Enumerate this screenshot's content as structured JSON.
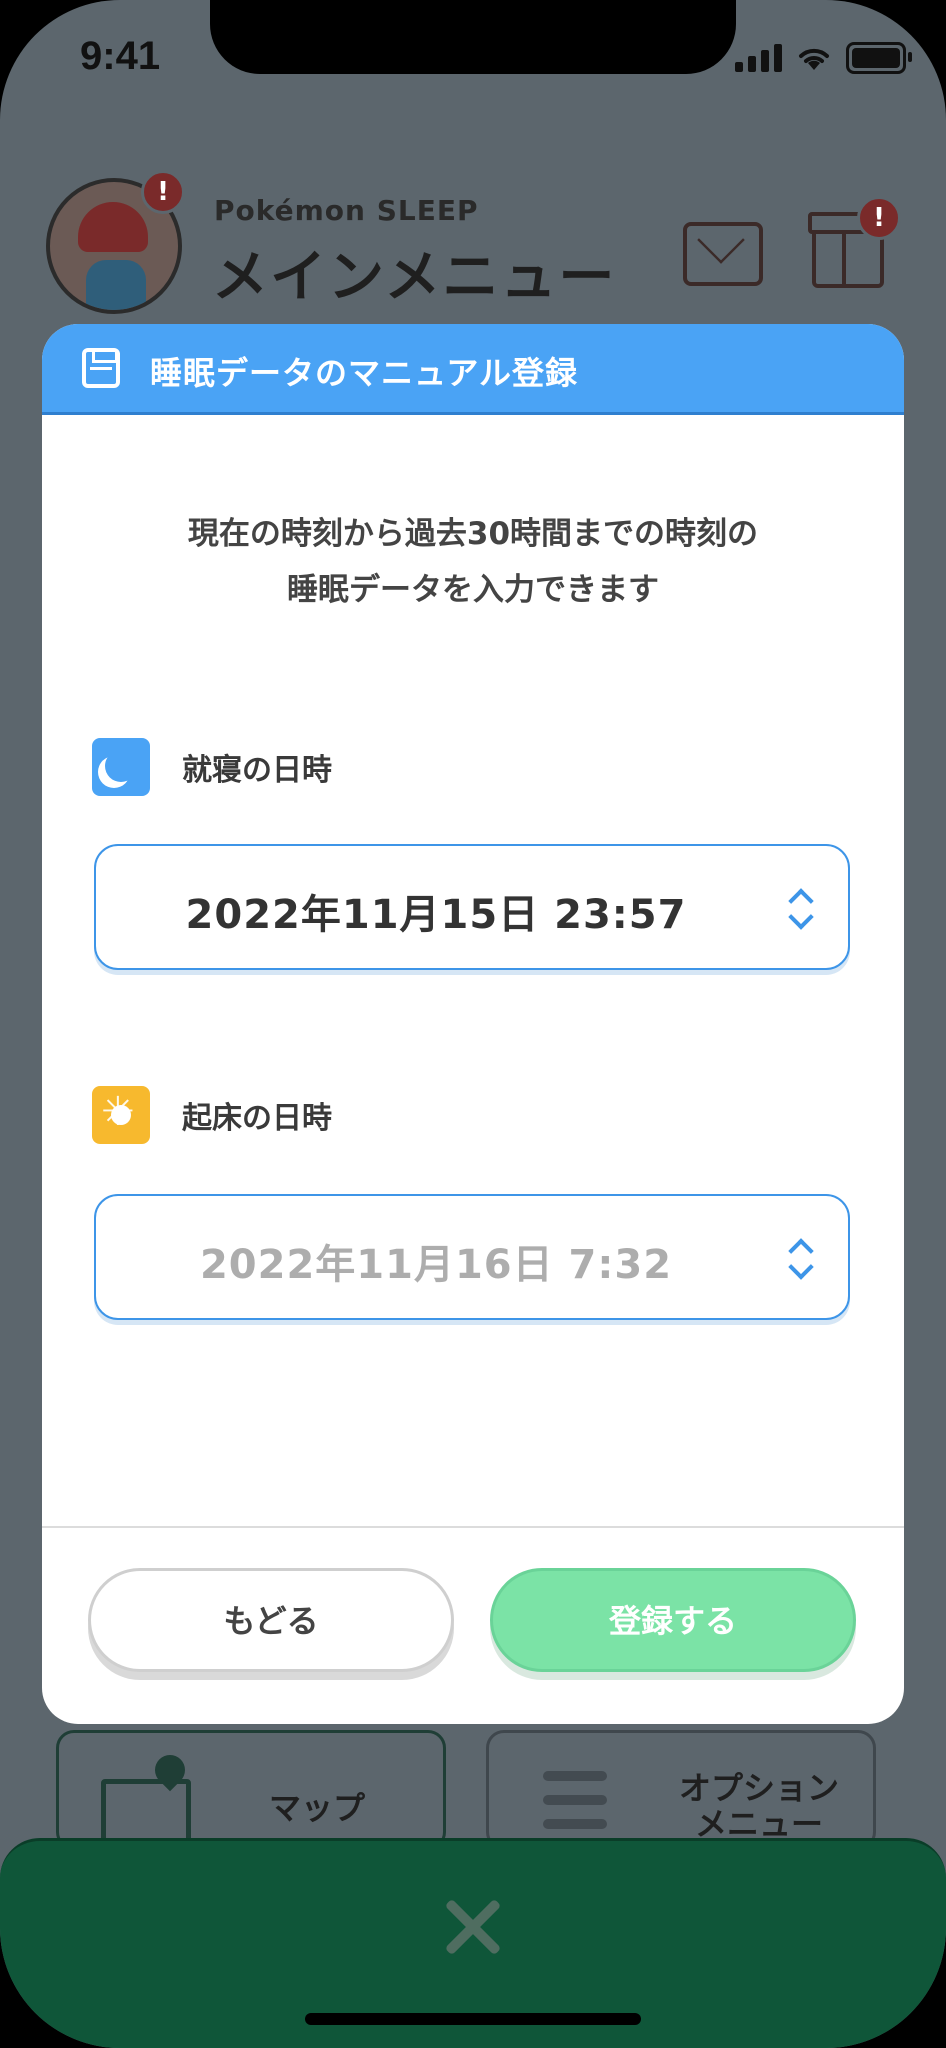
{
  "status_bar": {
    "time": "9:41"
  },
  "app_header": {
    "brand": "Pokémon SLEEP",
    "title": "メインメニュー",
    "badge": "!"
  },
  "background_menu": {
    "map_label": "マップ",
    "options_label_line1": "オプション",
    "options_label_line2": "メニュー"
  },
  "modal": {
    "title": "睡眠データのマニュアル登録",
    "description_line1": "現在の時刻から過去30時間までの時刻の",
    "description_line2": "睡眠データを入力できます",
    "bedtime": {
      "label": "就寝の日時",
      "value": "2022年11月15日  23:57"
    },
    "wake": {
      "label": "起床の日時",
      "value": "2022年11月16日  7:32"
    },
    "back_button": "もどる",
    "register_button": "登録する"
  },
  "colors": {
    "accent_blue": "#4aa3f5",
    "confirm_green": "#7be3a6",
    "sun_yellow": "#f7b92e",
    "bottom_bar": "#0f5639"
  }
}
